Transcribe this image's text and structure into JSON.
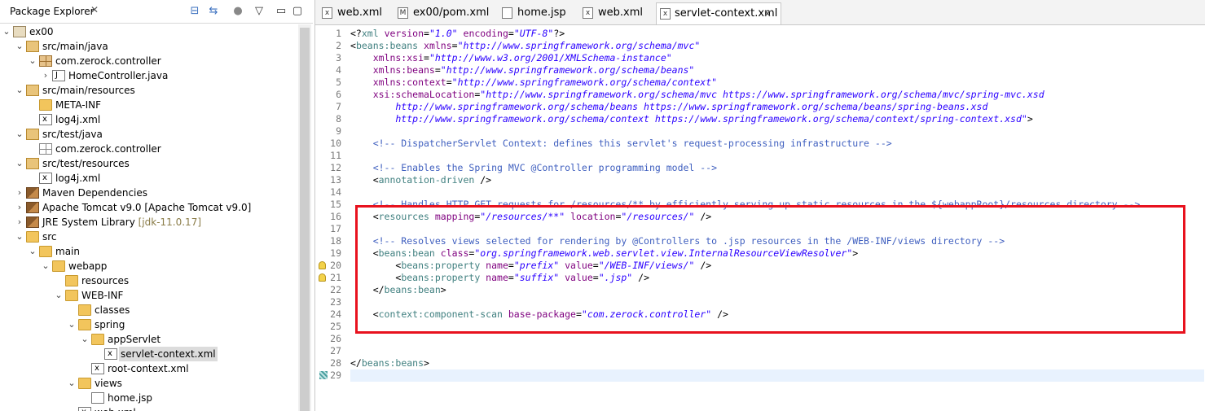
{
  "explorer": {
    "title": "Package Explorer",
    "tree": [
      {
        "label": "ex00",
        "icon": "project-icon",
        "depth": 0,
        "expanded": true
      },
      {
        "label": "src/main/java",
        "icon": "source-folder-icon",
        "depth": 1,
        "expanded": true
      },
      {
        "label": "com.zerock.controller",
        "icon": "package-icon",
        "depth": 2,
        "expanded": true
      },
      {
        "label": "HomeController.java",
        "icon": "java-file-icon",
        "depth": 3,
        "expanded": false
      },
      {
        "label": "src/main/resources",
        "icon": "source-folder-icon",
        "depth": 1,
        "expanded": true
      },
      {
        "label": "META-INF",
        "icon": "folder-icon",
        "depth": 2,
        "expanded": null
      },
      {
        "label": "log4j.xml",
        "icon": "xml-file-icon",
        "depth": 2,
        "expanded": null
      },
      {
        "label": "src/test/java",
        "icon": "source-folder-icon",
        "depth": 1,
        "expanded": true
      },
      {
        "label": "com.zerock.controller",
        "icon": "empty-package-icon",
        "depth": 2,
        "expanded": null
      },
      {
        "label": "src/test/resources",
        "icon": "source-folder-icon",
        "depth": 1,
        "expanded": true
      },
      {
        "label": "log4j.xml",
        "icon": "xml-file-icon",
        "depth": 2,
        "expanded": null
      },
      {
        "label": "Maven Dependencies",
        "icon": "library-icon",
        "depth": 1,
        "expanded": false
      },
      {
        "label": "Apache Tomcat v9.0 [Apache Tomcat v9.0]",
        "icon": "library-icon",
        "depth": 1,
        "expanded": false
      },
      {
        "label": "JRE System Library",
        "sub": "[jdk-11.0.17]",
        "icon": "library-icon",
        "depth": 1,
        "expanded": false
      },
      {
        "label": "src",
        "icon": "folder-icon",
        "depth": 1,
        "expanded": true
      },
      {
        "label": "main",
        "icon": "folder-icon",
        "depth": 2,
        "expanded": true
      },
      {
        "label": "webapp",
        "icon": "folder-icon",
        "depth": 3,
        "expanded": true
      },
      {
        "label": "resources",
        "icon": "folder-icon",
        "depth": 4,
        "expanded": null
      },
      {
        "label": "WEB-INF",
        "icon": "folder-icon",
        "depth": 4,
        "expanded": true
      },
      {
        "label": "classes",
        "icon": "folder-icon",
        "depth": 5,
        "expanded": null
      },
      {
        "label": "spring",
        "icon": "folder-icon",
        "depth": 5,
        "expanded": true
      },
      {
        "label": "appServlet",
        "icon": "folder-icon",
        "depth": 6,
        "expanded": true
      },
      {
        "label": "servlet-context.xml",
        "icon": "xml-file-icon",
        "depth": 7,
        "expanded": null,
        "selected": true
      },
      {
        "label": "root-context.xml",
        "icon": "xml-file-icon",
        "depth": 6,
        "expanded": null
      },
      {
        "label": "views",
        "icon": "folder-icon",
        "depth": 5,
        "expanded": true
      },
      {
        "label": "home.jsp",
        "icon": "jsp-file-icon",
        "depth": 6,
        "expanded": null
      },
      {
        "label": "web.xml",
        "icon": "xml-file-icon",
        "depth": 5,
        "expanded": null
      }
    ]
  },
  "editor": {
    "tabs": [
      {
        "label": "web.xml",
        "icon": "xml-file-icon",
        "active": false
      },
      {
        "label": "ex00/pom.xml",
        "icon": "maven-file-icon",
        "active": false
      },
      {
        "label": "home.jsp",
        "icon": "jsp-file-icon",
        "active": false
      },
      {
        "label": "web.xml",
        "icon": "xml-file-icon",
        "active": false
      },
      {
        "label": "servlet-context.xml",
        "icon": "xml-file-icon",
        "active": true
      }
    ],
    "lines": [
      "1",
      "2",
      "3",
      "4",
      "5",
      "6",
      "7",
      "8",
      "9",
      "10",
      "11",
      "12",
      "13",
      "14",
      "15",
      "16",
      "17",
      "18",
      "19",
      "20",
      "21",
      "22",
      "23",
      "24",
      "25",
      "26",
      "27",
      "28",
      "29"
    ],
    "code": [
      [
        [
          "p",
          "<?"
        ],
        [
          "t",
          "xml "
        ],
        [
          "a",
          "version"
        ],
        [
          "p",
          "="
        ],
        [
          "v",
          "\"1.0\""
        ],
        [
          "a",
          " encoding"
        ],
        [
          "p",
          "="
        ],
        [
          "v",
          "\"UTF-8\""
        ],
        [
          "p",
          "?>"
        ]
      ],
      [
        [
          "p",
          "<"
        ],
        [
          "t",
          "beans:beans "
        ],
        [
          "a",
          "xmlns"
        ],
        [
          "p",
          "="
        ],
        [
          "v",
          "\"http://www.springframework.org/schema/mvc\""
        ]
      ],
      [
        [
          "a",
          "    xmlns:xsi"
        ],
        [
          "p",
          "="
        ],
        [
          "v",
          "\"http://www.w3.org/2001/XMLSchema-instance\""
        ]
      ],
      [
        [
          "a",
          "    xmlns:beans"
        ],
        [
          "p",
          "="
        ],
        [
          "v",
          "\"http://www.springframework.org/schema/beans\""
        ]
      ],
      [
        [
          "a",
          "    xmlns:context"
        ],
        [
          "p",
          "="
        ],
        [
          "v",
          "\"http://www.springframework.org/schema/context\""
        ]
      ],
      [
        [
          "a",
          "    xsi:schemaLocation"
        ],
        [
          "p",
          "="
        ],
        [
          "v",
          "\"http://www.springframework.org/schema/mvc https://www.springframework.org/schema/mvc/spring-mvc.xsd"
        ]
      ],
      [
        [
          "v",
          "        http://www.springframework.org/schema/beans https://www.springframework.org/schema/beans/spring-beans.xsd"
        ]
      ],
      [
        [
          "v",
          "        http://www.springframework.org/schema/context https://www.springframework.org/schema/context/spring-context.xsd\""
        ],
        [
          "p",
          ">"
        ]
      ],
      [
        [
          "p",
          ""
        ]
      ],
      [
        [
          "c",
          "    <!-- DispatcherServlet Context: defines this servlet's request-processing infrastructure -->"
        ]
      ],
      [
        [
          "p",
          ""
        ]
      ],
      [
        [
          "c",
          "    <!-- Enables the Spring MVC @Controller programming model -->"
        ]
      ],
      [
        [
          "p",
          "    <"
        ],
        [
          "t",
          "annotation-driven "
        ],
        [
          "p",
          "/>"
        ]
      ],
      [
        [
          "p",
          ""
        ]
      ],
      [
        [
          "c",
          "    <!-- Handles HTTP GET requests for /resources/** by efficiently serving up static resources in the ${webappRoot}/resources directory -->"
        ]
      ],
      [
        [
          "p",
          "    <"
        ],
        [
          "t",
          "resources "
        ],
        [
          "a",
          "mapping"
        ],
        [
          "p",
          "="
        ],
        [
          "v",
          "\"/resources/**\""
        ],
        [
          "a",
          " location"
        ],
        [
          "p",
          "="
        ],
        [
          "v",
          "\"/resources/\""
        ],
        [
          "p",
          " />"
        ]
      ],
      [
        [
          "p",
          ""
        ]
      ],
      [
        [
          "c",
          "    <!-- Resolves views selected for rendering by @Controllers to .jsp resources in the /WEB-INF/views directory -->"
        ]
      ],
      [
        [
          "p",
          "    <"
        ],
        [
          "t",
          "beans:bean "
        ],
        [
          "a",
          "class"
        ],
        [
          "p",
          "="
        ],
        [
          "v",
          "\"org.springframework.web.servlet.view.InternalResourceViewResolver\""
        ],
        [
          "p",
          ">"
        ]
      ],
      [
        [
          "p",
          "        <"
        ],
        [
          "t",
          "beans:property "
        ],
        [
          "a",
          "name"
        ],
        [
          "p",
          "="
        ],
        [
          "v",
          "\"prefix\""
        ],
        [
          "a",
          " value"
        ],
        [
          "p",
          "="
        ],
        [
          "v",
          "\"/WEB-INF/views/\""
        ],
        [
          "p",
          " />"
        ]
      ],
      [
        [
          "p",
          "        <"
        ],
        [
          "t",
          "beans:property "
        ],
        [
          "a",
          "name"
        ],
        [
          "p",
          "="
        ],
        [
          "v",
          "\"suffix\""
        ],
        [
          "a",
          " value"
        ],
        [
          "p",
          "="
        ],
        [
          "v",
          "\".jsp\""
        ],
        [
          "p",
          " />"
        ]
      ],
      [
        [
          "p",
          "    </"
        ],
        [
          "t",
          "beans:bean"
        ],
        [
          "p",
          ">"
        ]
      ],
      [
        [
          "p",
          ""
        ]
      ],
      [
        [
          "p",
          "    <"
        ],
        [
          "t",
          "context:component-scan "
        ],
        [
          "a",
          "base-package"
        ],
        [
          "p",
          "="
        ],
        [
          "v",
          "\"com.zerock.controller\""
        ],
        [
          "p",
          " />"
        ]
      ],
      [
        [
          "p",
          ""
        ]
      ],
      [
        [
          "p",
          ""
        ]
      ],
      [
        [
          "p",
          ""
        ]
      ],
      [
        [
          "p",
          "</"
        ],
        [
          "t",
          "beans:beans"
        ],
        [
          "p",
          ">"
        ]
      ],
      [
        [
          "p",
          ""
        ]
      ]
    ],
    "warning_lines": [
      20,
      21
    ],
    "changed_line": 29,
    "current_line": 29,
    "highlight_color": "#e8121e"
  }
}
